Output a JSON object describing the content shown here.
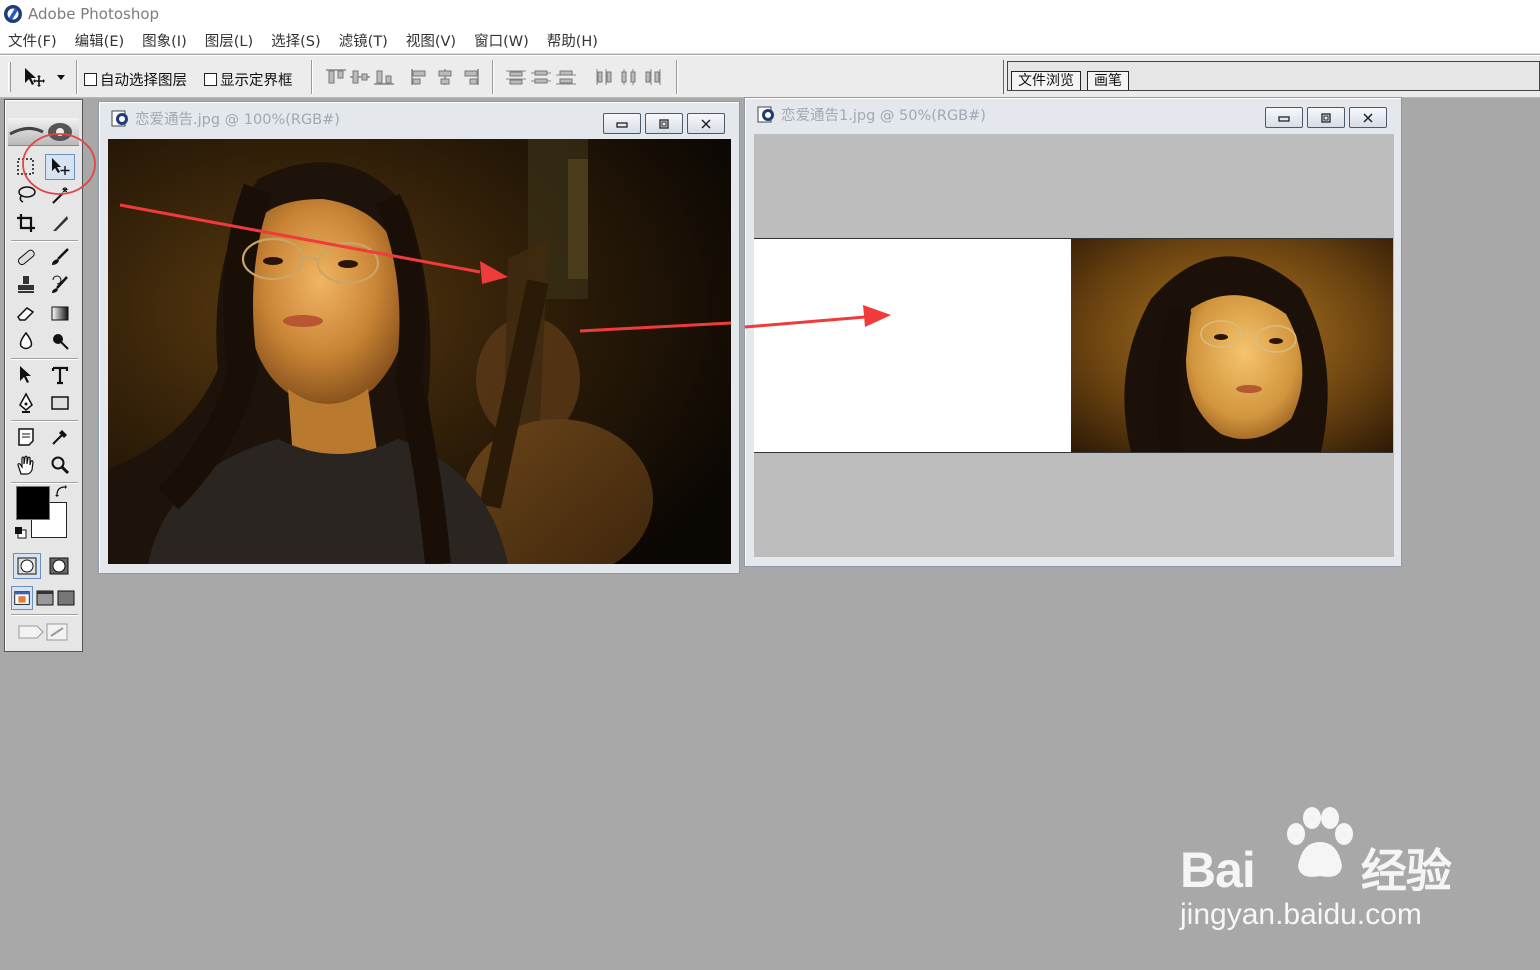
{
  "app": {
    "title": "Adobe Photoshop"
  },
  "menu": [
    "文件(F)",
    "编辑(E)",
    "图象(I)",
    "图层(L)",
    "选择(S)",
    "滤镜(T)",
    "视图(V)",
    "窗口(W)",
    "帮助(H)"
  ],
  "options": {
    "auto_select_label": "自动选择图层",
    "show_bounds_label": "显示定界框",
    "auto_select_checked": false,
    "show_bounds_checked": false
  },
  "palette_well": {
    "tabs": [
      "文件浏览",
      "画笔"
    ]
  },
  "toolbox": {
    "active_tool": "move-tool",
    "foreground_color": "#000000",
    "background_color": "#ffffff"
  },
  "documents": [
    {
      "title": "恋爱通告.jpg @ 100%(RGB#)"
    },
    {
      "title": "恋爱通告1.jpg @ 50%(RGB#)"
    }
  ],
  "annotations": {
    "arrow_color": "#ef3b3b",
    "circle_color": "#e04646"
  },
  "watermark": {
    "brand": "Bai",
    "brand_suffix": "经验",
    "url": "jingyan.baidu.com"
  }
}
